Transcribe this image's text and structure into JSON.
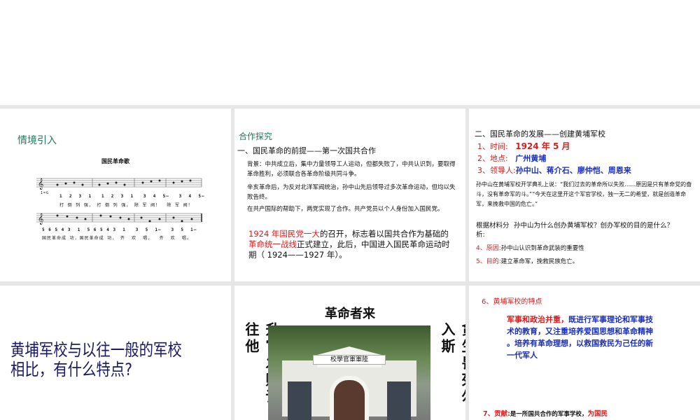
{
  "slides": [
    {
      "heading": "情境引入",
      "song_title": "国民革命歌",
      "key": "1=G",
      "line1_numbers": "1  2  3  1   1  2  3  1   3  4  5—   3  4  5—",
      "line1_lyrics": "打 倒 列 强， 打 倒 列 强， 除 军 阀！  除 军 阀！",
      "line2_numbers": "5 6 5 4 3  1  5 6 5 4 3  1   3  5  1—   3  5  1—",
      "line2_lyrics": "国民革命成 功，国民革命成 功， 齐  欢  唱，  齐  欢  唱。"
    },
    {
      "heading": "合作探究",
      "subtitle": "一、国民革命的前提——第一次国共合作",
      "p1": "背景：中共成立后，集中力量领导工人运动，但都失败了，中共认识到，要取得革命胜利，必须联合各革命阶级共同斗争。",
      "p2": "辛亥革命后，为反对北洋军阀统治，孙中山先后领导过多次革命运动，但均以失败告终。",
      "p3": "在共产国际的帮助下，两党实现了合作。共产党员以个人身份加入国民党。",
      "p4_red1": "1924 年国民党一大",
      "p4_a": "的召开，标志着以国共合作为基础的",
      "p4_red2": "革命统一战线",
      "p4_b": "正式建立，此后，中国进入国民革命运动时期（ 1924——1927 年）。"
    },
    {
      "title": "二、国民革命的发展——创建黄埔军校",
      "time_label": "1、时间:",
      "time_value": "1924 年 5 月",
      "place_label": "2、地点:",
      "place_value": "广州黄埔",
      "leader_label": "3、领导人:",
      "leader_value": "孙中山、蒋介石、廖仲恺、周恩来",
      "quote": "孙中山在黄埔军校开学典礼上说：“我们过去的革命所以失败……原因是只有革命党的奋斗，没有革命军的斗。”“今天在这里开这个军官学校，独一无二的希望，就是创造革命军，来挽救中国的危亡。”",
      "analysis_label": "根据材料分析:",
      "analysis_question": "孙中山为什么创办黄埔军校？创办军校的目的是什么？",
      "reason_label": "4、原因:",
      "reason_value": "孙中山认识到革命武装的重要性",
      "goal_label": "5、目的:",
      "goal_value": "建立革命军，挽救民族危亡。"
    },
    {
      "question": "黄埔军校与以往一般的军校相比，有什么特点?"
    },
    {
      "top": "革命者来",
      "left": "升官发财请往他",
      "right": "贪生畏死勿入斯",
      "gate_sign": "校學官軍軍陸"
    },
    {
      "title": "6、黄埔军校的特点",
      "red": "军事和政治并重，",
      "blue": "既进行军事理论和军事技术的教育，又注重培养爱国思想和革命精神 。培养有革命理想，以救国救民为己任的新一代军人",
      "contrib_label": "7、贡献:",
      "contrib_text": "是一所国共合作的军事学校，",
      "contrib_red": "为国民"
    }
  ]
}
